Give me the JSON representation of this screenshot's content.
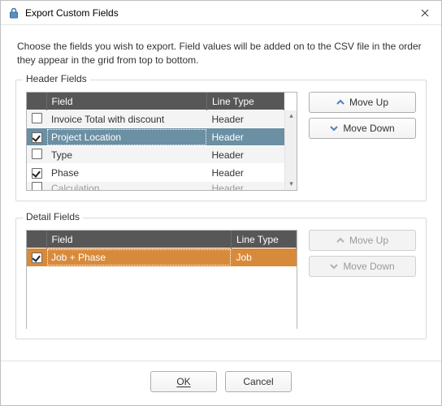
{
  "window": {
    "title": "Export Custom Fields",
    "instructions": "Choose the fields you wish to export. Field values will be added on to the CSV file in the order they appear in the grid from top to bottom."
  },
  "columns": {
    "field": "Field",
    "linetype": "Line Type"
  },
  "groups": {
    "header": {
      "label": "Header Fields",
      "move_up": "Move Up",
      "move_down": "Move Down",
      "move_up_enabled": true,
      "move_down_enabled": true
    },
    "detail": {
      "label": "Detail Fields",
      "move_up": "Move Up",
      "move_down": "Move Down",
      "move_up_enabled": false,
      "move_down_enabled": false
    }
  },
  "header_rows": [
    {
      "checked": false,
      "field": "Invoice Total with discount",
      "type": "Header",
      "selected": false
    },
    {
      "checked": true,
      "field": "Project Location",
      "type": "Header",
      "selected": true
    },
    {
      "checked": false,
      "field": "Type",
      "type": "Header",
      "selected": false
    },
    {
      "checked": true,
      "field": "Phase",
      "type": "Header",
      "selected": false
    },
    {
      "checked": false,
      "field": "Calculation",
      "type": "Header",
      "selected": false,
      "half": true
    }
  ],
  "detail_rows": [
    {
      "checked": true,
      "field": "Job + Phase",
      "type": "Job",
      "selected": true
    }
  ],
  "buttons": {
    "ok": "OK",
    "cancel": "Cancel"
  },
  "icons": {
    "lock": "lock-icon",
    "close": "close-icon"
  }
}
